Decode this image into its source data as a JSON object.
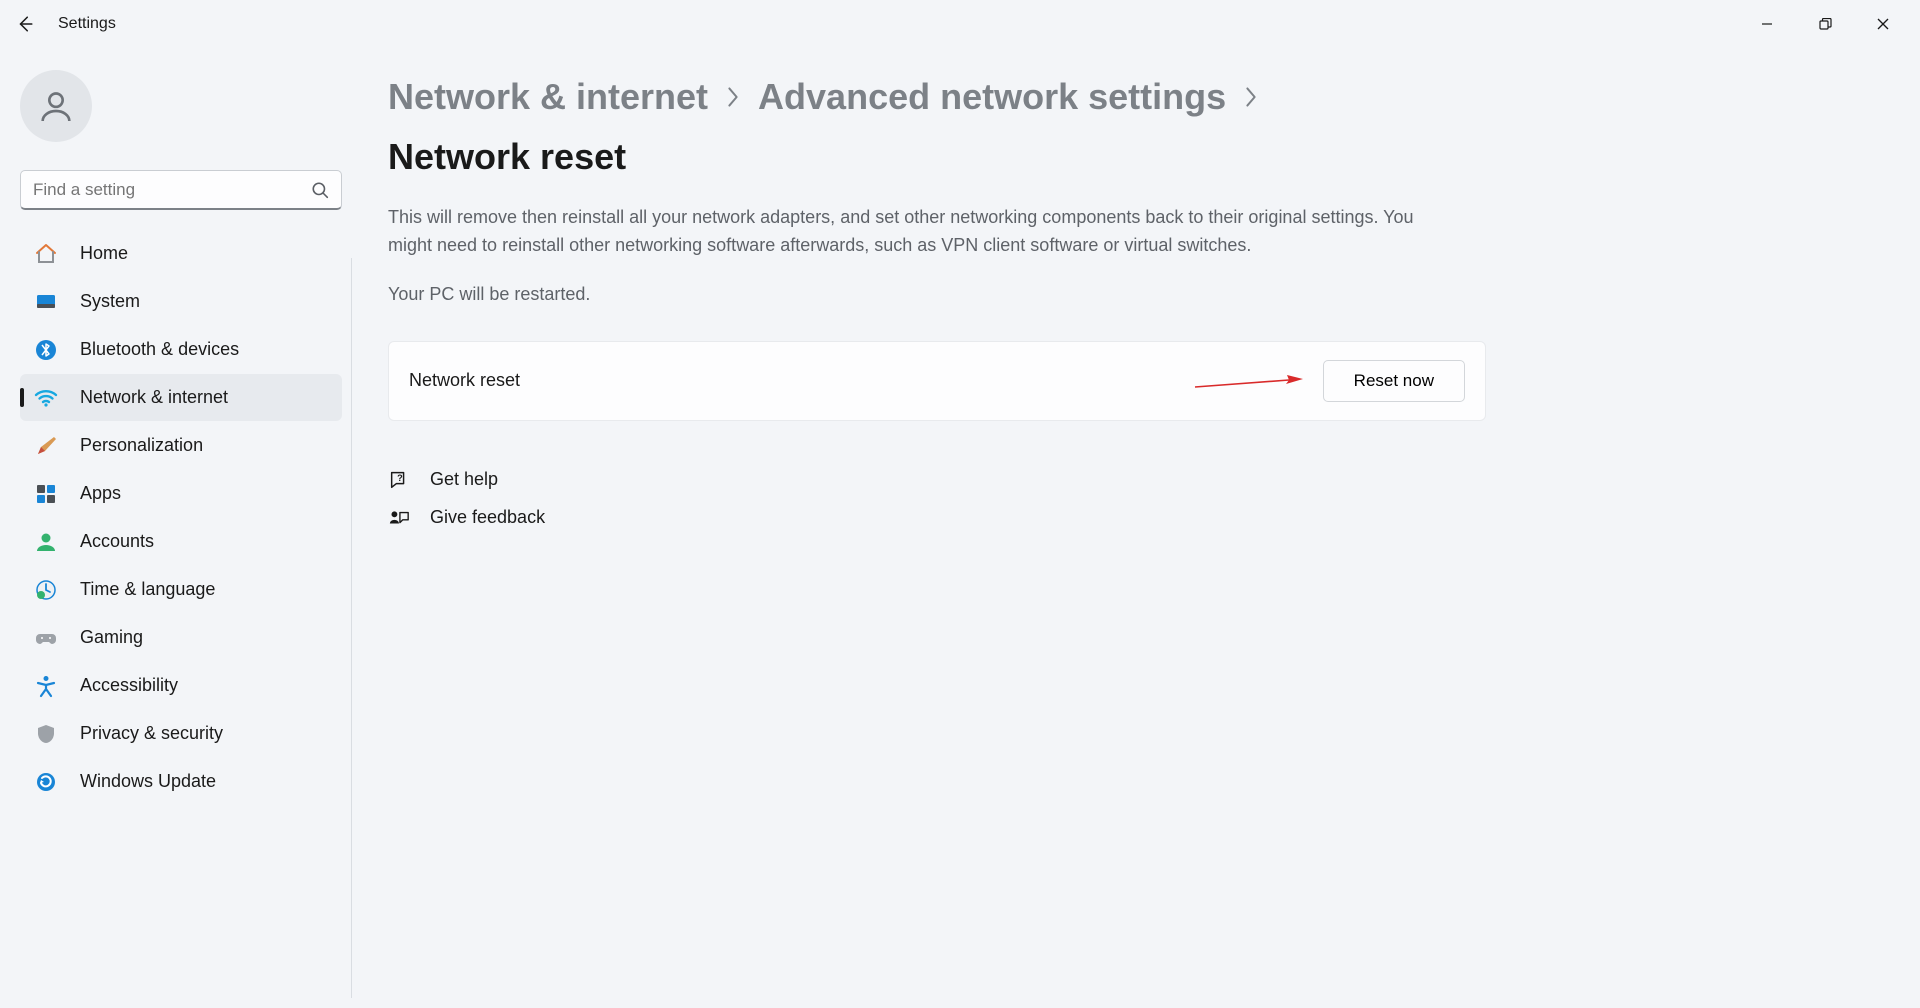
{
  "window": {
    "app_title": "Settings"
  },
  "search": {
    "placeholder": "Find a setting"
  },
  "sidebar": {
    "items": [
      {
        "label": "Home"
      },
      {
        "label": "System"
      },
      {
        "label": "Bluetooth & devices"
      },
      {
        "label": "Network & internet"
      },
      {
        "label": "Personalization"
      },
      {
        "label": "Apps"
      },
      {
        "label": "Accounts"
      },
      {
        "label": "Time & language"
      },
      {
        "label": "Gaming"
      },
      {
        "label": "Accessibility"
      },
      {
        "label": "Privacy & security"
      },
      {
        "label": "Windows Update"
      }
    ]
  },
  "breadcrumb": {
    "crumb1": "Network & internet",
    "crumb2": "Advanced network settings",
    "crumb3": "Network reset"
  },
  "content": {
    "description": "This will remove then reinstall all your network adapters, and set other networking components back to their original settings. You might need to reinstall other networking software afterwards, such as VPN client software or virtual switches.",
    "restart_note": "Your PC will be restarted.",
    "card_title": "Network reset",
    "reset_button": "Reset now",
    "get_help": "Get help",
    "give_feedback": "Give feedback"
  }
}
